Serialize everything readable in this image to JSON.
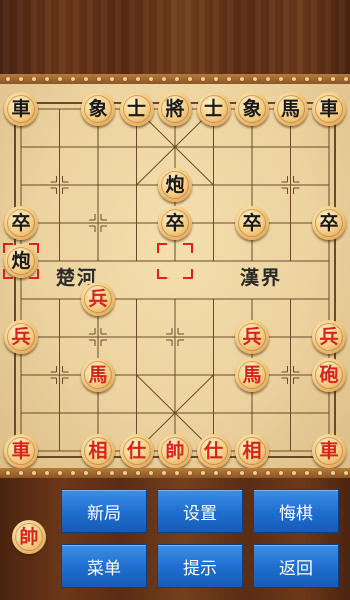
{
  "theme": {
    "red_piece_color": "#d8231b",
    "black_piece_color": "#1a1a1a",
    "button_color": "#1f6dcf",
    "selection_color": "#e0201a"
  },
  "board": {
    "river_left": "楚河",
    "river_right": "漢界",
    "pieces": [
      {
        "id": "b-chariot-l",
        "char": "車",
        "side": "black",
        "col": 0,
        "row": 0
      },
      {
        "id": "b-elephant-l",
        "char": "象",
        "side": "black",
        "col": 2,
        "row": 0
      },
      {
        "id": "b-advisor-l",
        "char": "士",
        "side": "black",
        "col": 3,
        "row": 0
      },
      {
        "id": "b-general",
        "char": "將",
        "side": "black",
        "col": 4,
        "row": 0
      },
      {
        "id": "b-advisor-r",
        "char": "士",
        "side": "black",
        "col": 5,
        "row": 0
      },
      {
        "id": "b-elephant-r",
        "char": "象",
        "side": "black",
        "col": 6,
        "row": 0
      },
      {
        "id": "b-horse-r",
        "char": "馬",
        "side": "black",
        "col": 7,
        "row": 0
      },
      {
        "id": "b-chariot-r",
        "char": "車",
        "side": "black",
        "col": 8,
        "row": 0
      },
      {
        "id": "b-cannon",
        "char": "炮",
        "side": "black",
        "col": 4,
        "row": 2
      },
      {
        "id": "b-soldier-1",
        "char": "卒",
        "side": "black",
        "col": 0,
        "row": 3
      },
      {
        "id": "b-soldier-3",
        "char": "卒",
        "side": "black",
        "col": 4,
        "row": 3
      },
      {
        "id": "b-soldier-4",
        "char": "卒",
        "side": "black",
        "col": 6,
        "row": 3
      },
      {
        "id": "b-soldier-5",
        "char": "卒",
        "side": "black",
        "col": 8,
        "row": 3
      },
      {
        "id": "b-cannon-moved",
        "char": "炮",
        "side": "black",
        "col": 0,
        "row": 4
      },
      {
        "id": "r-soldier-2",
        "char": "兵",
        "side": "red",
        "col": 2,
        "row": 5
      },
      {
        "id": "r-soldier-1",
        "char": "兵",
        "side": "red",
        "col": 0,
        "row": 6
      },
      {
        "id": "r-soldier-4",
        "char": "兵",
        "side": "red",
        "col": 6,
        "row": 6
      },
      {
        "id": "r-soldier-5",
        "char": "兵",
        "side": "red",
        "col": 8,
        "row": 6
      },
      {
        "id": "r-horse-l",
        "char": "馬",
        "side": "red",
        "col": 2,
        "row": 7
      },
      {
        "id": "r-horse-r",
        "char": "馬",
        "side": "red",
        "col": 6,
        "row": 7
      },
      {
        "id": "r-cannon-r",
        "char": "砲",
        "side": "red",
        "col": 8,
        "row": 7
      },
      {
        "id": "r-chariot-l",
        "char": "車",
        "side": "red",
        "col": 0,
        "row": 9
      },
      {
        "id": "r-elephant-l",
        "char": "相",
        "side": "red",
        "col": 2,
        "row": 9
      },
      {
        "id": "r-advisor-l",
        "char": "仕",
        "side": "red",
        "col": 3,
        "row": 9
      },
      {
        "id": "r-general",
        "char": "帥",
        "side": "red",
        "col": 4,
        "row": 9
      },
      {
        "id": "r-advisor-r",
        "char": "仕",
        "side": "red",
        "col": 5,
        "row": 9
      },
      {
        "id": "r-elephant-r",
        "char": "相",
        "side": "red",
        "col": 6,
        "row": 9
      },
      {
        "id": "r-chariot-r",
        "char": "車",
        "side": "red",
        "col": 8,
        "row": 9
      }
    ],
    "selections": [
      {
        "col": 0,
        "row": 4
      },
      {
        "col": 4,
        "row": 4
      }
    ]
  },
  "panel": {
    "turn_piece": "帥",
    "buttons": {
      "new_game": "新局",
      "settings": "设置",
      "undo": "悔棋",
      "menu": "菜单",
      "hint": "提示",
      "back": "返回"
    }
  }
}
